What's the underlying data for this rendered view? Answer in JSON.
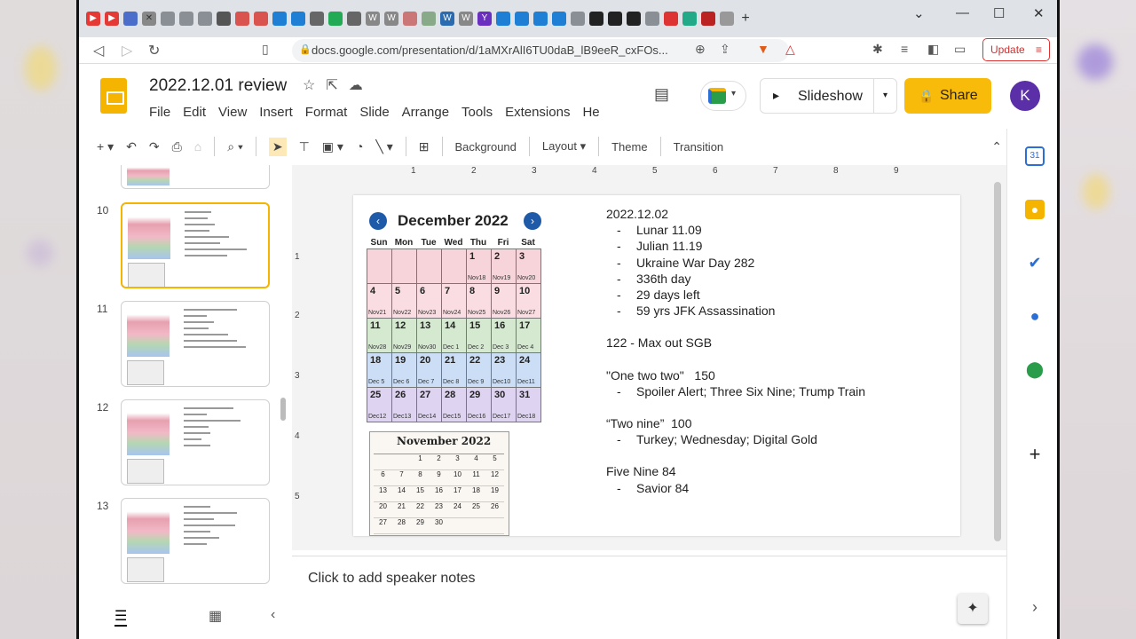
{
  "browser": {
    "url": "docs.google.com/presentation/d/1aMXrAlI6TU0daB_lB9eeR_cxFOs...",
    "update_label": "Update",
    "window_controls": [
      "chevron-down-icon",
      "minimize-icon",
      "maximize-icon",
      "close-icon"
    ]
  },
  "doc": {
    "title": "2022.12.01 review",
    "menu": [
      "File",
      "Edit",
      "View",
      "Insert",
      "Format",
      "Slide",
      "Arrange",
      "Tools",
      "Extensions",
      "He"
    ]
  },
  "header": {
    "slideshow_label": "Slideshow",
    "share_label": "Share",
    "avatar_letter": "K",
    "accent_color": "#f9bb09"
  },
  "toolbar": {
    "background_label": "Background",
    "layout_label": "Layout",
    "theme_label": "Theme",
    "transition_label": "Transition"
  },
  "filmstrip": {
    "slide_numbers": [
      "10",
      "11",
      "12",
      "13"
    ],
    "active_slide": "10"
  },
  "slide": {
    "calendar": {
      "title": "December 2022",
      "weekdays": [
        "Sun",
        "Mon",
        "Tue",
        "Wed",
        "Thu",
        "Fri",
        "Sat"
      ],
      "cells": [
        {
          "d": "",
          "s": ""
        },
        {
          "d": "",
          "s": ""
        },
        {
          "d": "",
          "s": ""
        },
        {
          "d": "",
          "s": ""
        },
        {
          "d": "1",
          "s": "Nov18"
        },
        {
          "d": "2",
          "s": "Nov19"
        },
        {
          "d": "3",
          "s": "Nov20"
        },
        {
          "d": "4",
          "s": "Nov21"
        },
        {
          "d": "5",
          "s": "Nov22"
        },
        {
          "d": "6",
          "s": "Nov23"
        },
        {
          "d": "7",
          "s": "Nov24"
        },
        {
          "d": "8",
          "s": "Nov25"
        },
        {
          "d": "9",
          "s": "Nov26"
        },
        {
          "d": "10",
          "s": "Nov27"
        },
        {
          "d": "11",
          "s": "Nov28"
        },
        {
          "d": "12",
          "s": "Nov29"
        },
        {
          "d": "13",
          "s": "Nov30"
        },
        {
          "d": "14",
          "s": "Dec 1"
        },
        {
          "d": "15",
          "s": "Dec 2"
        },
        {
          "d": "16",
          "s": "Dec 3"
        },
        {
          "d": "17",
          "s": "Dec 4"
        },
        {
          "d": "18",
          "s": "Dec 5"
        },
        {
          "d": "19",
          "s": "Dec 6"
        },
        {
          "d": "20",
          "s": "Dec 7"
        },
        {
          "d": "21",
          "s": "Dec 8"
        },
        {
          "d": "22",
          "s": "Dec 9"
        },
        {
          "d": "23",
          "s": "Dec10"
        },
        {
          "d": "24",
          "s": "Dec11"
        },
        {
          "d": "25",
          "s": "Dec12"
        },
        {
          "d": "26",
          "s": "Dec13"
        },
        {
          "d": "27",
          "s": "Dec14"
        },
        {
          "d": "28",
          "s": "Dec15"
        },
        {
          "d": "29",
          "s": "Dec16"
        },
        {
          "d": "30",
          "s": "Dec17"
        },
        {
          "d": "31",
          "s": "Dec18"
        }
      ]
    },
    "november": {
      "title": "November 2022",
      "days": [
        "",
        "",
        "1",
        "2",
        "3",
        "4",
        "5",
        "6",
        "7",
        "8",
        "9",
        "10",
        "11",
        "12",
        "13",
        "14",
        "15",
        "16",
        "17",
        "18",
        "19",
        "20",
        "21",
        "22",
        "23",
        "24",
        "25",
        "26",
        "27",
        "28",
        "29",
        "30",
        "",
        "",
        ""
      ]
    },
    "text": {
      "heading": "2022.12.02",
      "items1": [
        "Lunar 11.09",
        "Julian 11.19",
        "Ukraine War Day 282",
        "336th day",
        "29 days left",
        "59 yrs JFK Assassination"
      ],
      "line2": "122 - Max out SGB",
      "line3": "\"One two two\"   150",
      "items3": [
        "Spoiler Alert; Three Six Nine; Trump Train"
      ],
      "line4": "“Two nine”  100",
      "items4": [
        "Turkey; Wednesday; Digital Gold"
      ],
      "line5": "Five Nine 84",
      "items5": [
        "Savior 84"
      ]
    }
  },
  "speaker_notes": {
    "placeholder": "Click to add speaker notes"
  }
}
